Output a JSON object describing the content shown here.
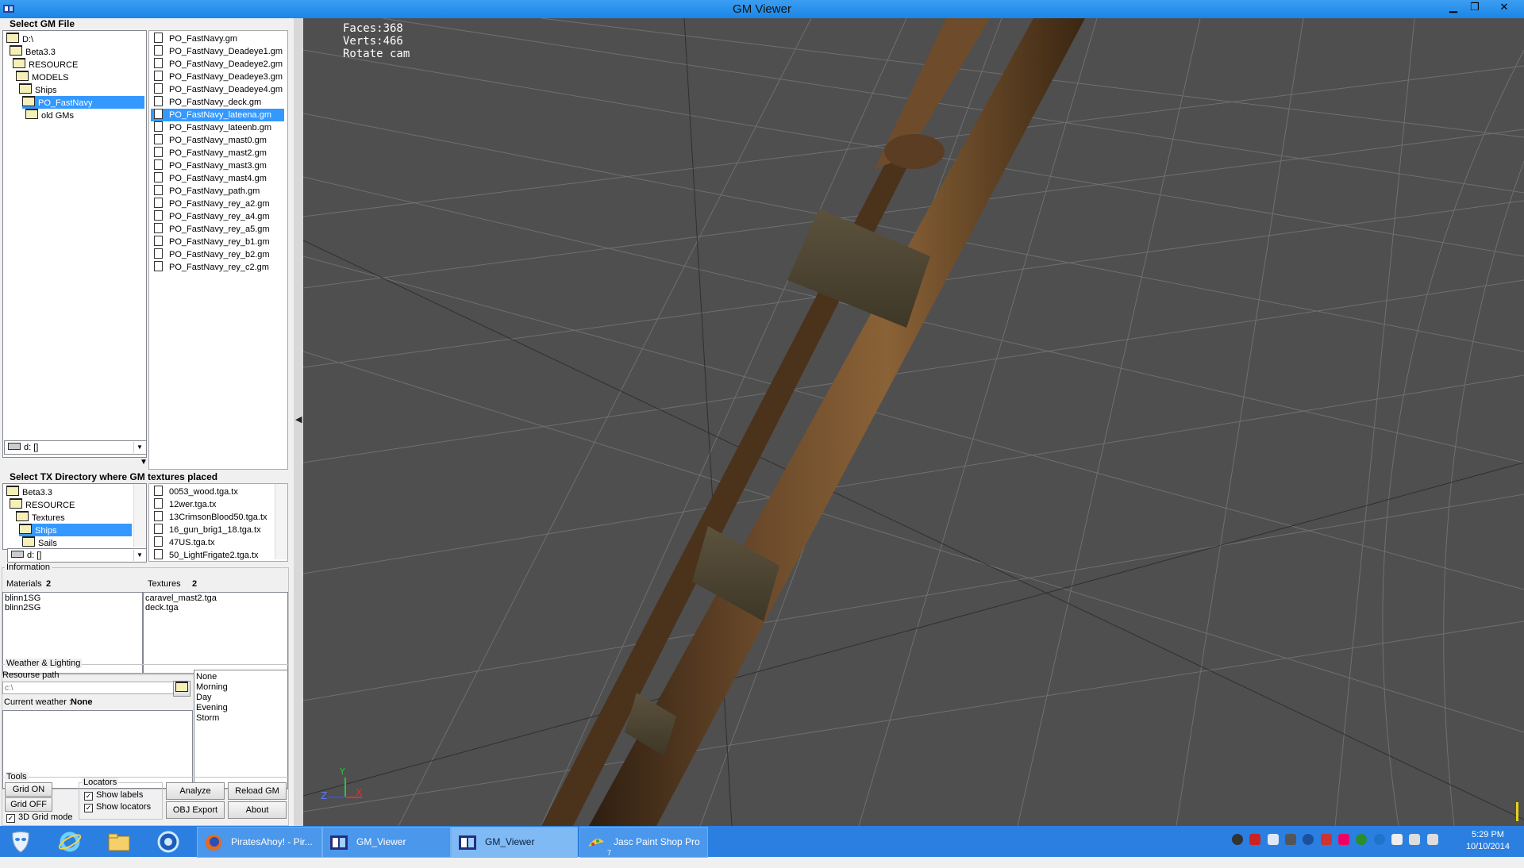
{
  "window": {
    "title": "GM Viewer"
  },
  "gm_file": {
    "header": "Select GM File",
    "tree": [
      "D:\\",
      "Beta3.3",
      "RESOURCE",
      "MODELS",
      "Ships",
      "PO_FastNavy",
      "old GMs"
    ],
    "selected_folder": "PO_FastNavy",
    "files": [
      "PO_FastNavy.gm",
      "PO_FastNavy_Deadeye1.gm",
      "PO_FastNavy_Deadeye2.gm",
      "PO_FastNavy_Deadeye3.gm",
      "PO_FastNavy_Deadeye4.gm",
      "PO_FastNavy_deck.gm",
      "PO_FastNavy_lateena.gm",
      "PO_FastNavy_lateenb.gm",
      "PO_FastNavy_mast0.gm",
      "PO_FastNavy_mast2.gm",
      "PO_FastNavy_mast3.gm",
      "PO_FastNavy_mast4.gm",
      "PO_FastNavy_path.gm",
      "PO_FastNavy_rey_a2.gm",
      "PO_FastNavy_rey_a4.gm",
      "PO_FastNavy_rey_a5.gm",
      "PO_FastNavy_rey_b1.gm",
      "PO_FastNavy_rey_b2.gm",
      "PO_FastNavy_rey_c2.gm"
    ],
    "selected_file": "PO_FastNavy_lateena.gm",
    "drive": "d: []"
  },
  "tx_dir": {
    "header": "Select TX Directory where GM textures placed",
    "tree": [
      "Beta3.3",
      "RESOURCE",
      "Textures",
      "Ships",
      "Sails"
    ],
    "selected_folder": "Ships",
    "files": [
      "0053_wood.tga.tx",
      "12wer.tga.tx",
      "13CrimsonBlood50.tga.tx",
      "16_gun_brig1_18.tga.tx",
      "47US.tga.tx",
      "50_LightFrigate2.tga.tx"
    ],
    "drive": "d: []"
  },
  "information": {
    "title": "Information",
    "materials_label": "Materials",
    "materials_count": "2",
    "textures_label": "Textures",
    "textures_count": "2",
    "materials": [
      "blinn1SG",
      "blinn2SG"
    ],
    "textures": [
      "caravel_mast2.tga",
      "deck.tga"
    ]
  },
  "weather": {
    "title": "Weather & Lighting",
    "resource_path_label": "Resourse path",
    "resource_path_placeholder": "c:\\",
    "current_label": "Current weather :",
    "current_value": "None",
    "options": [
      "None",
      "Morning",
      "Day",
      "Evening",
      "Storm"
    ]
  },
  "tools": {
    "title": "Tools",
    "grid_on": "Grid ON",
    "grid_off": "Grid OFF",
    "grid_3d": "3D Grid mode",
    "locators_title": "Locators",
    "show_labels": "Show labels",
    "show_locators": "Show locators",
    "analyze": "Analyze",
    "reload": "Reload GM",
    "obj_export": "OBJ Export",
    "about": "About"
  },
  "viewport": {
    "faces": "Faces:368",
    "verts": "Verts:466",
    "mode": "Rotate cam",
    "axis_z": "Z",
    "axis_y": "Y",
    "axis_x": "X"
  },
  "taskbar": {
    "tasks": [
      "PiratesAhoy! - Pir...",
      "GM_Viewer",
      "GM_Viewer",
      "Jasc Paint Shop Pro"
    ],
    "task_badge": "7",
    "time": "5:29 PM",
    "date": "10/10/2014"
  },
  "colors": {
    "selection": "#3399ff",
    "taskbar": "#2a7fe0",
    "viewport_bg": "#4f4f4f",
    "titlebar": "#1a86e6"
  }
}
